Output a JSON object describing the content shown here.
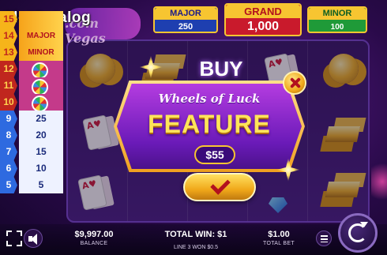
{
  "watermark": {
    "text": "SlotCatalog"
  },
  "game_logo": {
    "text": ".com Vegas"
  },
  "jackpots": {
    "major": {
      "label": "MAJOR",
      "value": "250"
    },
    "grand": {
      "label": "GRAND",
      "value": "1,000"
    },
    "minor": {
      "label": "MINOR",
      "value": "100"
    }
  },
  "ladder": [
    {
      "num": "15",
      "value": "",
      "kind": "prize"
    },
    {
      "num": "14",
      "value": "MAJOR",
      "kind": "prize"
    },
    {
      "num": "13",
      "value": "MINOR",
      "kind": "prize"
    },
    {
      "num": "12",
      "value": "",
      "kind": "wheel"
    },
    {
      "num": "11",
      "value": "",
      "kind": "wheel"
    },
    {
      "num": "10",
      "value": "",
      "kind": "wheel"
    },
    {
      "num": "9",
      "value": "25",
      "kind": "line"
    },
    {
      "num": "8",
      "value": "20",
      "kind": "line"
    },
    {
      "num": "7",
      "value": "15",
      "kind": "line"
    },
    {
      "num": "6",
      "value": "10",
      "kind": "line"
    },
    {
      "num": "5",
      "value": "5",
      "kind": "line"
    }
  ],
  "buy_feature": {
    "title": "BUY",
    "subtitle": "Wheels of Luck",
    "feature": "FEATURE",
    "price": "$55",
    "confirm_icon": "checkmark-icon",
    "close_icon": "close-icon"
  },
  "bottom": {
    "balance_value": "$9,997.00",
    "balance_label": "BALANCE",
    "total_win_value": "TOTAL WIN: $1",
    "total_win_sub": "LINE 3 WON $0.5",
    "total_bet_value": "$1.00",
    "total_bet_label": "TOTAL BET"
  },
  "icons": [
    "fullscreen-icon",
    "sound-icon",
    "paytable-icon",
    "spin-icon"
  ],
  "colors": {
    "major": "#1e3fb0",
    "grand": "#c91a2c",
    "minor": "#1f9a38",
    "gold": "#f7c531",
    "feature_purple": "#6a1ab8"
  }
}
